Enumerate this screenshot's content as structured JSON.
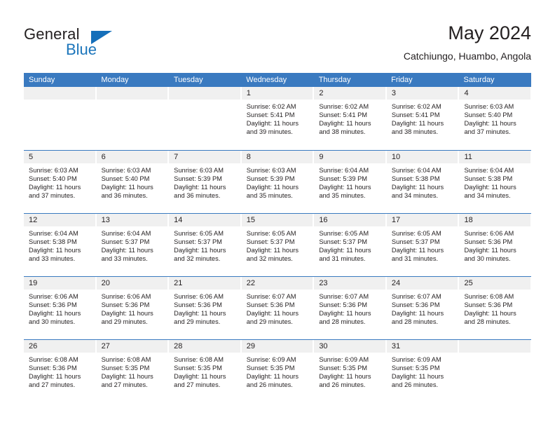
{
  "brand": {
    "name_top": "General",
    "name_bottom": "Blue",
    "triangle_color": "#156fba",
    "blue_color": "#1b75bb"
  },
  "header": {
    "title": "May 2024",
    "subtitle": "Catchiungo, Huambo, Angola"
  },
  "theme": {
    "header_blue": "#3a7ac0",
    "daynum_band": "#f0f0f0",
    "text": "#231f20"
  },
  "weekday_headers": [
    "Sunday",
    "Monday",
    "Tuesday",
    "Wednesday",
    "Thursday",
    "Friday",
    "Saturday"
  ],
  "labels": {
    "sunrise_prefix": "Sunrise:",
    "sunset_prefix": "Sunset:",
    "daylight_prefix": "Daylight:"
  },
  "weeks": [
    [
      {
        "empty": true
      },
      {
        "empty": true
      },
      {
        "empty": true
      },
      {
        "day": "1",
        "sunrise": "Sunrise: 6:02 AM",
        "sunset": "Sunset: 5:41 PM",
        "daylight_l1": "Daylight: 11 hours",
        "daylight_l2": "and 39 minutes."
      },
      {
        "day": "2",
        "sunrise": "Sunrise: 6:02 AM",
        "sunset": "Sunset: 5:41 PM",
        "daylight_l1": "Daylight: 11 hours",
        "daylight_l2": "and 38 minutes."
      },
      {
        "day": "3",
        "sunrise": "Sunrise: 6:02 AM",
        "sunset": "Sunset: 5:41 PM",
        "daylight_l1": "Daylight: 11 hours",
        "daylight_l2": "and 38 minutes."
      },
      {
        "day": "4",
        "sunrise": "Sunrise: 6:03 AM",
        "sunset": "Sunset: 5:40 PM",
        "daylight_l1": "Daylight: 11 hours",
        "daylight_l2": "and 37 minutes."
      }
    ],
    [
      {
        "day": "5",
        "sunrise": "Sunrise: 6:03 AM",
        "sunset": "Sunset: 5:40 PM",
        "daylight_l1": "Daylight: 11 hours",
        "daylight_l2": "and 37 minutes."
      },
      {
        "day": "6",
        "sunrise": "Sunrise: 6:03 AM",
        "sunset": "Sunset: 5:40 PM",
        "daylight_l1": "Daylight: 11 hours",
        "daylight_l2": "and 36 minutes."
      },
      {
        "day": "7",
        "sunrise": "Sunrise: 6:03 AM",
        "sunset": "Sunset: 5:39 PM",
        "daylight_l1": "Daylight: 11 hours",
        "daylight_l2": "and 36 minutes."
      },
      {
        "day": "8",
        "sunrise": "Sunrise: 6:03 AM",
        "sunset": "Sunset: 5:39 PM",
        "daylight_l1": "Daylight: 11 hours",
        "daylight_l2": "and 35 minutes."
      },
      {
        "day": "9",
        "sunrise": "Sunrise: 6:04 AM",
        "sunset": "Sunset: 5:39 PM",
        "daylight_l1": "Daylight: 11 hours",
        "daylight_l2": "and 35 minutes."
      },
      {
        "day": "10",
        "sunrise": "Sunrise: 6:04 AM",
        "sunset": "Sunset: 5:38 PM",
        "daylight_l1": "Daylight: 11 hours",
        "daylight_l2": "and 34 minutes."
      },
      {
        "day": "11",
        "sunrise": "Sunrise: 6:04 AM",
        "sunset": "Sunset: 5:38 PM",
        "daylight_l1": "Daylight: 11 hours",
        "daylight_l2": "and 34 minutes."
      }
    ],
    [
      {
        "day": "12",
        "sunrise": "Sunrise: 6:04 AM",
        "sunset": "Sunset: 5:38 PM",
        "daylight_l1": "Daylight: 11 hours",
        "daylight_l2": "and 33 minutes."
      },
      {
        "day": "13",
        "sunrise": "Sunrise: 6:04 AM",
        "sunset": "Sunset: 5:37 PM",
        "daylight_l1": "Daylight: 11 hours",
        "daylight_l2": "and 33 minutes."
      },
      {
        "day": "14",
        "sunrise": "Sunrise: 6:05 AM",
        "sunset": "Sunset: 5:37 PM",
        "daylight_l1": "Daylight: 11 hours",
        "daylight_l2": "and 32 minutes."
      },
      {
        "day": "15",
        "sunrise": "Sunrise: 6:05 AM",
        "sunset": "Sunset: 5:37 PM",
        "daylight_l1": "Daylight: 11 hours",
        "daylight_l2": "and 32 minutes."
      },
      {
        "day": "16",
        "sunrise": "Sunrise: 6:05 AM",
        "sunset": "Sunset: 5:37 PM",
        "daylight_l1": "Daylight: 11 hours",
        "daylight_l2": "and 31 minutes."
      },
      {
        "day": "17",
        "sunrise": "Sunrise: 6:05 AM",
        "sunset": "Sunset: 5:37 PM",
        "daylight_l1": "Daylight: 11 hours",
        "daylight_l2": "and 31 minutes."
      },
      {
        "day": "18",
        "sunrise": "Sunrise: 6:06 AM",
        "sunset": "Sunset: 5:36 PM",
        "daylight_l1": "Daylight: 11 hours",
        "daylight_l2": "and 30 minutes."
      }
    ],
    [
      {
        "day": "19",
        "sunrise": "Sunrise: 6:06 AM",
        "sunset": "Sunset: 5:36 PM",
        "daylight_l1": "Daylight: 11 hours",
        "daylight_l2": "and 30 minutes."
      },
      {
        "day": "20",
        "sunrise": "Sunrise: 6:06 AM",
        "sunset": "Sunset: 5:36 PM",
        "daylight_l1": "Daylight: 11 hours",
        "daylight_l2": "and 29 minutes."
      },
      {
        "day": "21",
        "sunrise": "Sunrise: 6:06 AM",
        "sunset": "Sunset: 5:36 PM",
        "daylight_l1": "Daylight: 11 hours",
        "daylight_l2": "and 29 minutes."
      },
      {
        "day": "22",
        "sunrise": "Sunrise: 6:07 AM",
        "sunset": "Sunset: 5:36 PM",
        "daylight_l1": "Daylight: 11 hours",
        "daylight_l2": "and 29 minutes."
      },
      {
        "day": "23",
        "sunrise": "Sunrise: 6:07 AM",
        "sunset": "Sunset: 5:36 PM",
        "daylight_l1": "Daylight: 11 hours",
        "daylight_l2": "and 28 minutes."
      },
      {
        "day": "24",
        "sunrise": "Sunrise: 6:07 AM",
        "sunset": "Sunset: 5:36 PM",
        "daylight_l1": "Daylight: 11 hours",
        "daylight_l2": "and 28 minutes."
      },
      {
        "day": "25",
        "sunrise": "Sunrise: 6:08 AM",
        "sunset": "Sunset: 5:36 PM",
        "daylight_l1": "Daylight: 11 hours",
        "daylight_l2": "and 28 minutes."
      }
    ],
    [
      {
        "day": "26",
        "sunrise": "Sunrise: 6:08 AM",
        "sunset": "Sunset: 5:36 PM",
        "daylight_l1": "Daylight: 11 hours",
        "daylight_l2": "and 27 minutes."
      },
      {
        "day": "27",
        "sunrise": "Sunrise: 6:08 AM",
        "sunset": "Sunset: 5:35 PM",
        "daylight_l1": "Daylight: 11 hours",
        "daylight_l2": "and 27 minutes."
      },
      {
        "day": "28",
        "sunrise": "Sunrise: 6:08 AM",
        "sunset": "Sunset: 5:35 PM",
        "daylight_l1": "Daylight: 11 hours",
        "daylight_l2": "and 27 minutes."
      },
      {
        "day": "29",
        "sunrise": "Sunrise: 6:09 AM",
        "sunset": "Sunset: 5:35 PM",
        "daylight_l1": "Daylight: 11 hours",
        "daylight_l2": "and 26 minutes."
      },
      {
        "day": "30",
        "sunrise": "Sunrise: 6:09 AM",
        "sunset": "Sunset: 5:35 PM",
        "daylight_l1": "Daylight: 11 hours",
        "daylight_l2": "and 26 minutes."
      },
      {
        "day": "31",
        "sunrise": "Sunrise: 6:09 AM",
        "sunset": "Sunset: 5:35 PM",
        "daylight_l1": "Daylight: 11 hours",
        "daylight_l2": "and 26 minutes."
      },
      {
        "empty": true
      }
    ]
  ]
}
